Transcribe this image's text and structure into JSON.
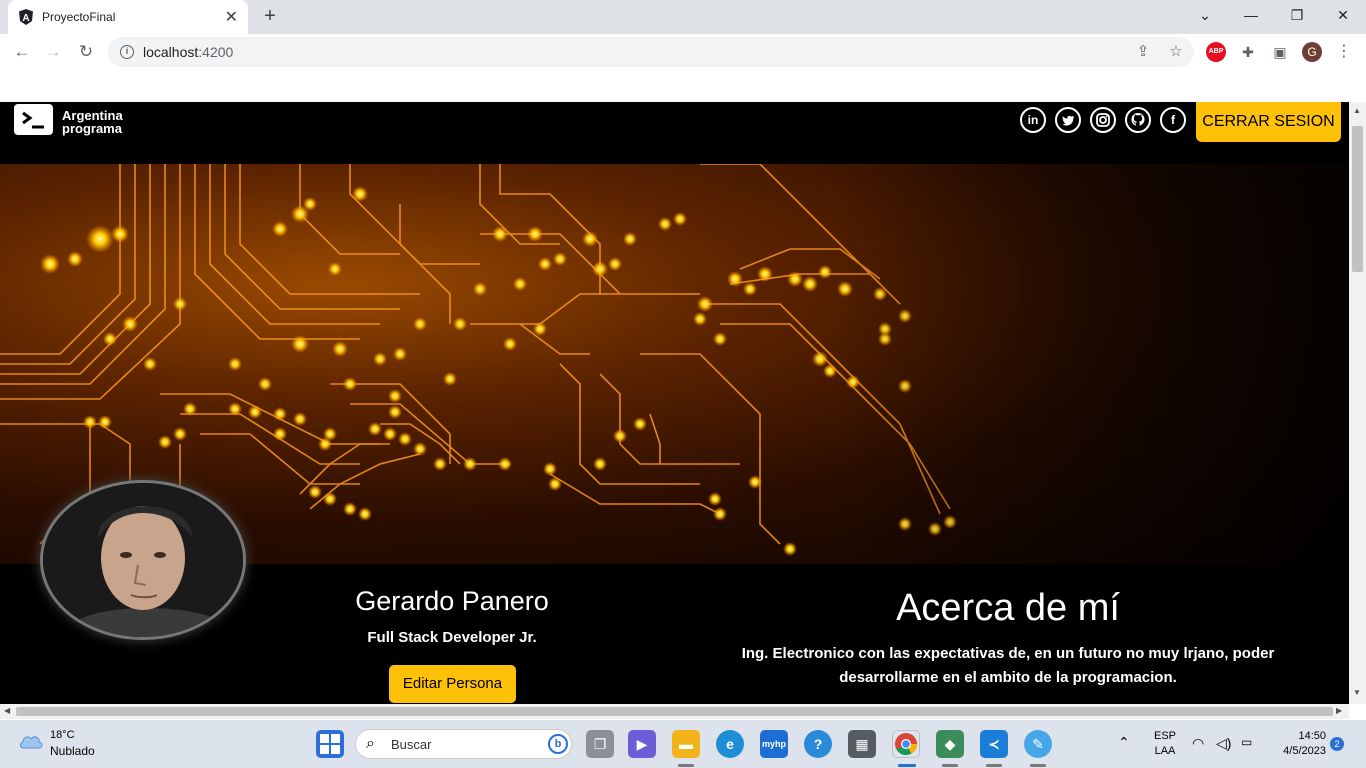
{
  "browser": {
    "tab_title": "ProyectoFinal",
    "tab_close": "✕",
    "new_tab": "+",
    "url_host": "localhost",
    "url_port": ":4200",
    "window_controls": {
      "minimize": "—",
      "maximize": "❐",
      "close": "✕",
      "tab_search": "⌄"
    },
    "profile_initial": "G",
    "abp_label": "ABP"
  },
  "site": {
    "logo_line1": "Argentina",
    "logo_line2": "programa",
    "social": [
      "in",
      "t",
      "ig",
      "gh",
      "f"
    ],
    "logout_label": "CERRAR SESION"
  },
  "person": {
    "name": "Gerardo Panero",
    "role": "Full Stack Developer Jr.",
    "edit_label": "Editar Persona"
  },
  "about": {
    "title": "Acerca de mí",
    "text": "Ing. Electronico con las expectativas de, en un futuro no muy lrjano, poder desarrollarme en el ambito de la programacion."
  },
  "taskbar": {
    "temp": "18°C",
    "condition": "Nublado",
    "search_placeholder": "Buscar",
    "lang_line1": "ESP",
    "lang_line2": "LAA",
    "time": "14:50",
    "date": "4/5/2023",
    "notifications": "2"
  },
  "colors": {
    "accent": "#ffc107",
    "chrome_bg": "#dee1e6",
    "page_bg": "#000000"
  }
}
